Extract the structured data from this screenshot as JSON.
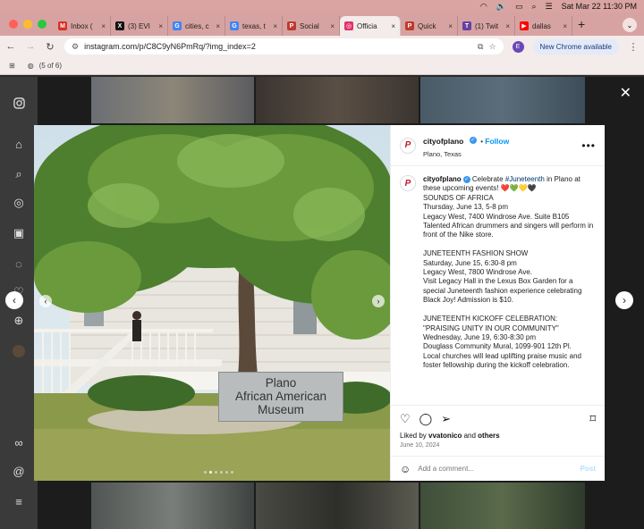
{
  "menubar": {
    "datetime": "Sat Mar 22  11:30 PM"
  },
  "tabs": [
    {
      "label": "Inbox (",
      "color": "#d93025",
      "glyph": "M"
    },
    {
      "label": "(3) EVI",
      "color": "#111111",
      "glyph": "X"
    },
    {
      "label": "cities, c",
      "color": "#4285f4",
      "glyph": "G"
    },
    {
      "label": "texas, t",
      "color": "#4285f4",
      "glyph": "G"
    },
    {
      "label": "Social",
      "color": "#c0392b",
      "glyph": "P"
    },
    {
      "label": "Officia",
      "color": "#e1306c",
      "glyph": "◎",
      "active": true
    },
    {
      "label": "Quick",
      "color": "#c0392b",
      "glyph": "P"
    },
    {
      "label": "(1) Twit",
      "color": "#6441a5",
      "glyph": "T"
    },
    {
      "label": "dallas",
      "color": "#ff0000",
      "glyph": "▶"
    }
  ],
  "toolbar": {
    "url": "instagram.com/p/C8C9yN6PmRq/?img_index=2",
    "profile_initial": "E",
    "new_chrome": "New Chrome available"
  },
  "bookmarks": {
    "counter": "(5 of 6)"
  },
  "post": {
    "account": "cityofplano",
    "follow": "Follow",
    "location": "Plano, Texas",
    "caption_prefix": " Celebrate ",
    "hashtag": "#Juneteenth",
    "caption_suffix": " in Plano at these upcoming events! ❤️💚💛🖤",
    "caption_body": "\nSOUNDS OF AFRICA\nThursday, June 13, 5-8 pm\nLegacy West, 7400 Windrose Ave. Suite B105\nTalented African drummers and singers will perform in front of the Nike store.\n\nJUNETEENTH FASHION SHOW\nSaturday, June 15, 6:30-8 pm\nLegacy West, 7800 Windrose Ave.\nVisit Legacy Hall in the Lexus Box Garden for a special Juneteenth fashion experience celebrating Black Joy! Admission is $10.\n\nJUNETEENTH KICKOFF CELEBRATION: \"PRAISING UNITY IN OUR COMMUNITY\"\nWednesday, June 19, 6:30-8:30 pm\nDouglass Community Mural, 1099-901 12th Pl.\nLocal churches will lead uplifting praise music and foster fellowship during the kickoff celebration.",
    "liked_by_prefix": "Liked by ",
    "liked_by_user": "vvatonico",
    "liked_by_mid": " and ",
    "liked_by_others": "others",
    "date": "June 10, 2024",
    "comment_placeholder": "Add a comment...",
    "post_label": "Post"
  },
  "photo": {
    "sign_line1": "Plano",
    "sign_line2": "African American",
    "sign_line3": "Museum",
    "image_index": 2,
    "image_count": 6
  }
}
